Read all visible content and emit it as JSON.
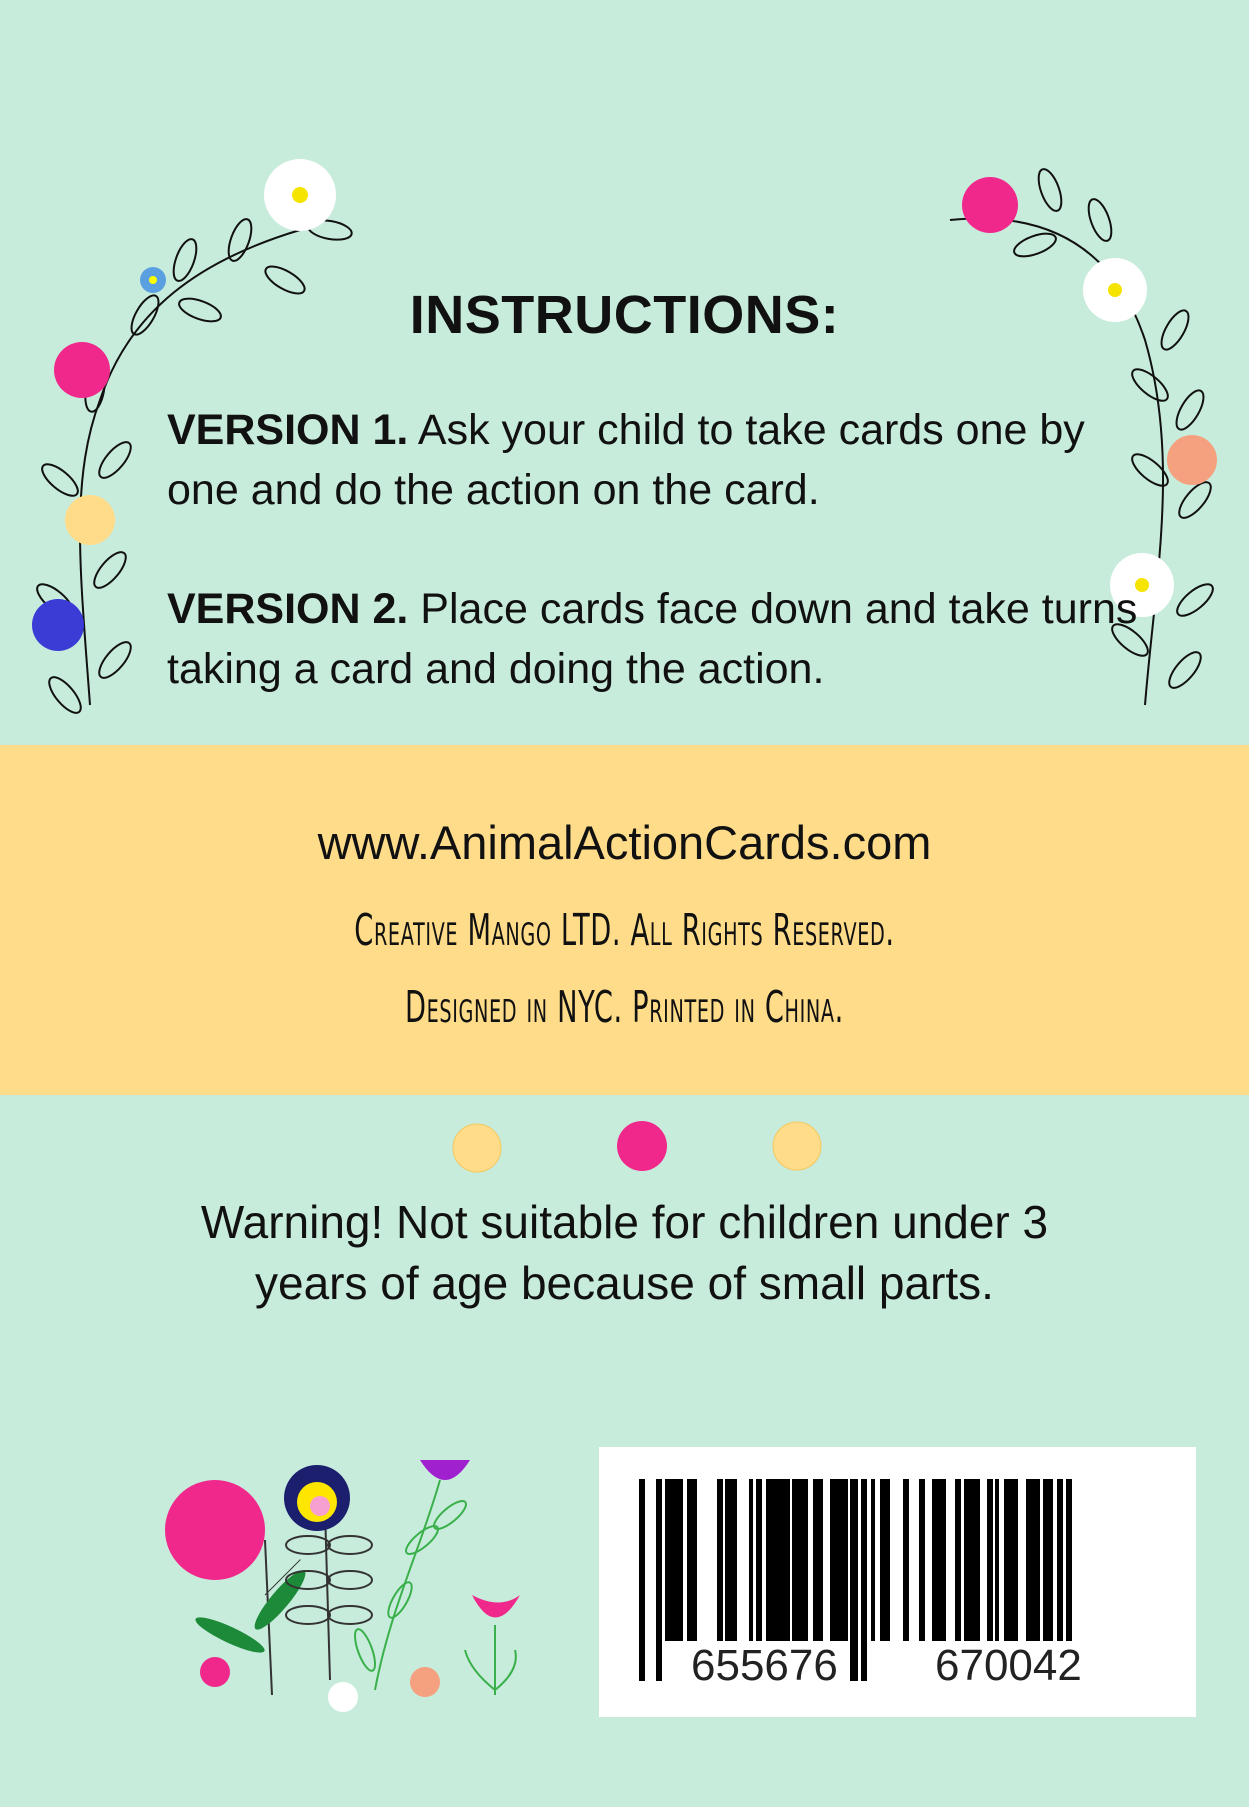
{
  "instructions": {
    "title": "INSTRUCTIONS:",
    "version1_label": "VERSION 1.",
    "version1_text": " Ask your child to take cards one by one and do the action on the card.",
    "version2_label": "VERSION 2.",
    "version2_text": " Place cards face down and take turns taking a card and doing the action."
  },
  "info": {
    "website": "www.AnimalActionCards.com",
    "copyright": "Creative Mango LTD. All Rights Reserved.",
    "origin": "Designed in NYC. Printed in China."
  },
  "warning": {
    "line1": "Warning! Not suitable for children under 3",
    "line2": "years of age because of small parts."
  },
  "barcode": {
    "left_digits": "655676",
    "right_digits": "670042"
  },
  "colors": {
    "background": "#c8ecdc",
    "band": "#ffdc8a",
    "pink": "#f0288c",
    "yellow": "#ffdc8a",
    "blue": "#3b3bd6",
    "salmon": "#f5a07e"
  }
}
